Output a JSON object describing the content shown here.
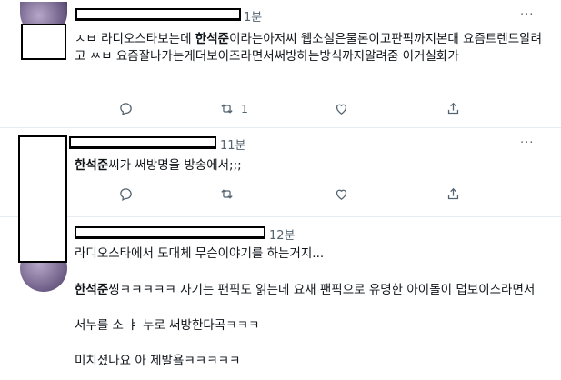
{
  "tweets": [
    {
      "time": "1분",
      "more": "···",
      "text_pre": "ㅅㅂ 라디오스타보는데 ",
      "text_bold": "한석준",
      "text_post": "이라는아저씨 웹소설은물론이고판픽까지본대 요즘트렌드알려고 ㅆㅂ 요즘잘나가는게더보이즈라면서써방하는방식까지알려줌 이거실화가",
      "actions": {
        "reply_icon": "reply-icon",
        "retweet_icon": "retweet-icon",
        "retweet_count": "1",
        "like_icon": "heart-icon",
        "share_icon": "share-icon"
      }
    },
    {
      "time": "11분",
      "more": "···",
      "text_bold": "한석준",
      "text_post": "씨가 써방명을 방송에서;;;",
      "actions": {
        "reply_icon": "reply-icon",
        "retweet_icon": "retweet-icon",
        "like_icon": "heart-icon",
        "share_icon": "share-icon"
      }
    },
    {
      "time": "12분",
      "line1": "라디오스타에서 도대체 무슨이야기를 하는거지...",
      "text_bold": "한석준",
      "line2_post": "씽ㅋㅋㅋㅋㅋ 자기는 팬픽도 읽는데 요새 팬픽으로 유명한 아이돌이 덥보이스라면서",
      "line3": "서누를 소 ㅑ 누로 써방한다곡ㅋㅋㅋ",
      "line4": "미치셨나요 아 제발욬ㅋㅋㅋㅋㅋ"
    }
  ]
}
